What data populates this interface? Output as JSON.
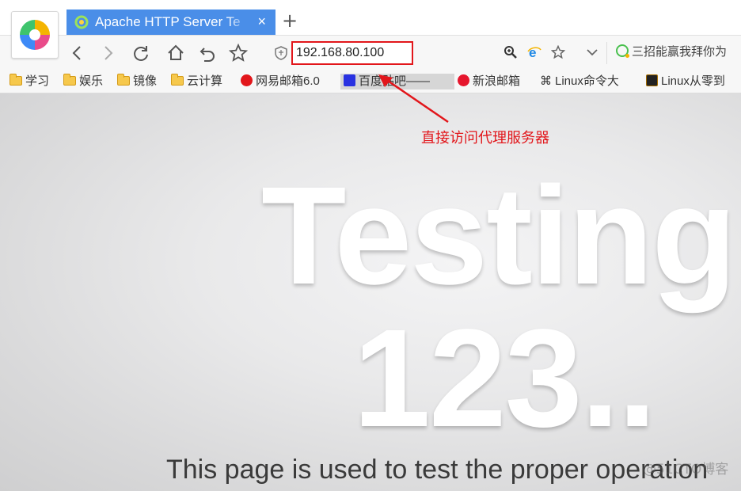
{
  "browser": {
    "tab": {
      "title": "Apache HTTP Server Te",
      "close_label": "×"
    },
    "new_tab_label": "+",
    "address": {
      "value": "192.168.80.100"
    },
    "search": {
      "text": "三招能赢我拜你为"
    }
  },
  "bookmarks": [
    {
      "label": "学习",
      "icon": "folder-icon"
    },
    {
      "label": "娱乐",
      "icon": "folder-icon"
    },
    {
      "label": "镜像",
      "icon": "folder-icon"
    },
    {
      "label": "云计算",
      "icon": "folder-icon"
    },
    {
      "label": "网易邮箱6.0",
      "icon": "netease-icon"
    },
    {
      "label": "百度贴吧——",
      "icon": "baidu-icon"
    },
    {
      "label": "新浪邮箱",
      "icon": "sina-icon"
    },
    {
      "label": "Linux命令大",
      "icon": "linux-cmd-icon"
    },
    {
      "label": "Linux从零到",
      "icon": "linux-icon"
    }
  ],
  "page": {
    "heading_line1": "Testing",
    "heading_line2": "123..",
    "paragraph": "This page is used to test the proper operation"
  },
  "annotation": {
    "text": "直接访问代理服务器",
    "color": "#e2161b"
  },
  "watermark": "@51CTO博客",
  "colors": {
    "tab_active": "#4a8ee8",
    "highlight": "#e2161b"
  }
}
